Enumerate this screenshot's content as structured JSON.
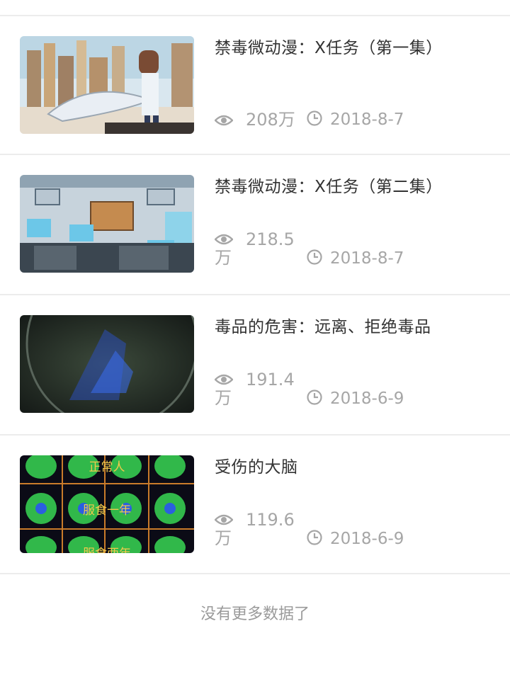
{
  "videos": [
    {
      "title": "禁毒微动漫：X任务（第一集）",
      "views": "208万",
      "date": "2018-8-7"
    },
    {
      "title": "禁毒微动漫：X任务（第二集）",
      "views": "218.5万",
      "date": "2018-8-7"
    },
    {
      "title": "毒品的危害：远离、拒绝毒品",
      "views": "191.4万",
      "date": "2018-6-9"
    },
    {
      "title": "受伤的大脑",
      "views": "119.6万",
      "date": "2018-6-9"
    }
  ],
  "thumb_text": {
    "brain_label_1": "正常人",
    "brain_label_2": "服食一年",
    "brain_label_3": "服食两年"
  },
  "footer": {
    "no_more": "没有更多数据了"
  },
  "icons": {
    "views": "eye-icon",
    "date": "clock-icon"
  },
  "colors": {
    "text_primary": "#333333",
    "text_secondary": "#a6a6a6",
    "divider": "#ececec"
  }
}
